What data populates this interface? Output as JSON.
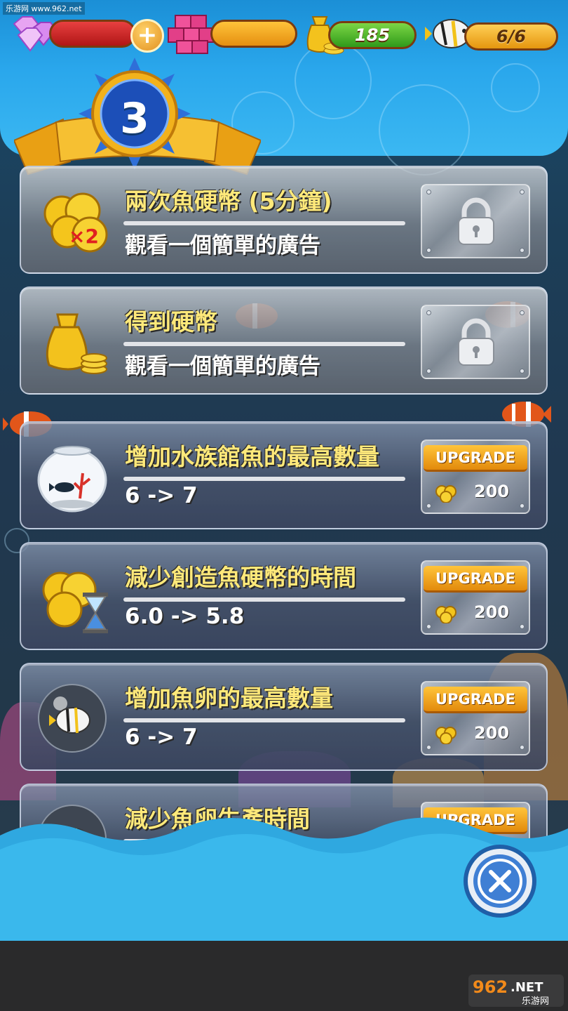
{
  "watermark_top": "乐游网 www.962.net",
  "hud": {
    "coins": "185",
    "fish_count": "6/6",
    "plus_label": "+"
  },
  "level": {
    "number": "3"
  },
  "cards": [
    {
      "title": "兩次魚硬幣 (5分鐘)",
      "subtitle": "觀看一個簡單的廣告",
      "icon": "coins-x2-icon",
      "action": "locked"
    },
    {
      "title": "得到硬幣",
      "subtitle": "觀看一個簡單的廣告",
      "icon": "money-bag-icon",
      "action": "locked"
    },
    {
      "title": "增加水族館魚的最高數量",
      "subtitle": "6 -> 7",
      "icon": "fish-bowl-icon",
      "action": "upgrade",
      "button_label": "UPGRADE",
      "cost": "200"
    },
    {
      "title": "減少創造魚硬幣的時間",
      "subtitle": "6.0 -> 5.8",
      "icon": "coins-hourglass-icon",
      "action": "upgrade",
      "button_label": "UPGRADE",
      "cost": "200"
    },
    {
      "title": "增加魚卵的最高數量",
      "subtitle": "6 -> 7",
      "icon": "fish-egg-icon",
      "action": "upgrade",
      "button_label": "UPGRADE",
      "cost": "200"
    },
    {
      "title": "減少魚卵生產時間",
      "subtitle": "",
      "icon": "fish-egg-icon",
      "action": "upgrade",
      "button_label": "UPGRADE",
      "cost": ""
    }
  ],
  "logo": {
    "brand": "962",
    "net": ".NET",
    "sub": "乐游网"
  },
  "colors": {
    "title_yellow": "#ffe97a",
    "upgrade_orange": "#f2a51c",
    "wave_blue": "#35b6ea"
  }
}
